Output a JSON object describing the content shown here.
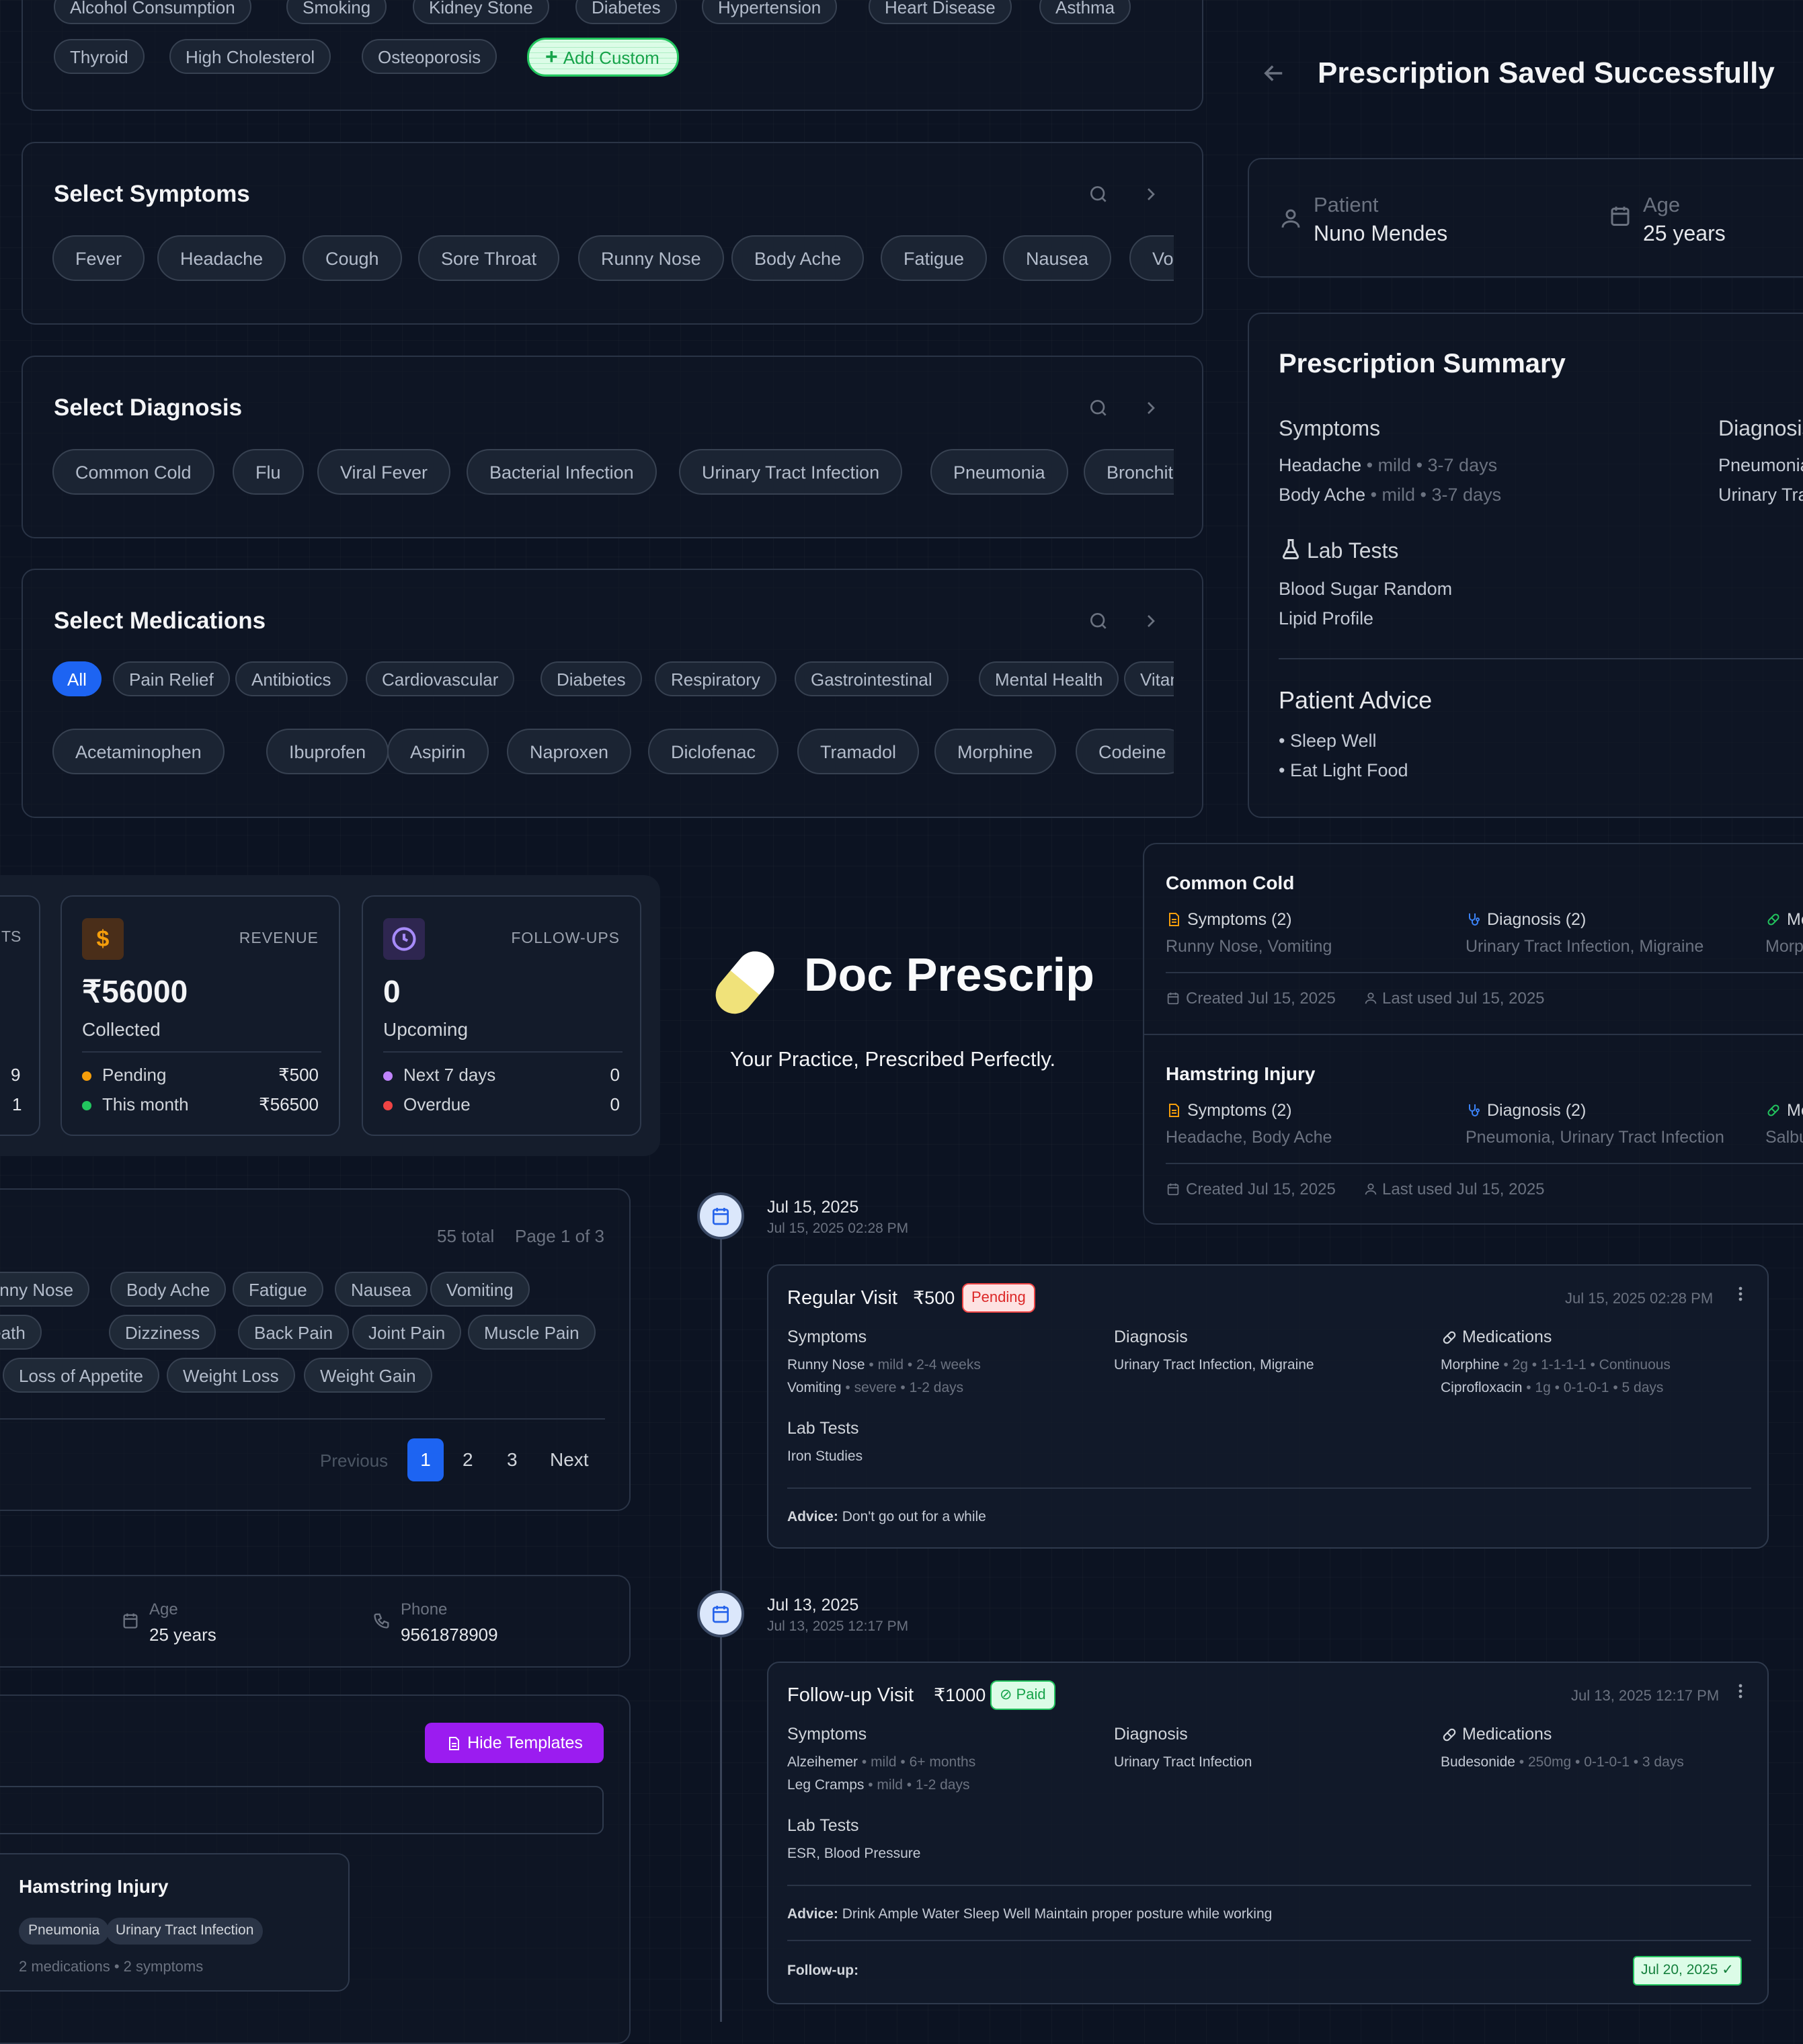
{
  "history_chips": [
    "Alcohol Consumption",
    "Smoking",
    "Kidney Stone",
    "Diabetes",
    "Hypertension",
    "Heart Disease",
    "Asthma",
    "Thyroid",
    "High Cholesterol",
    "Osteoporosis"
  ],
  "add_custom_label": "Add Custom",
  "symptoms": {
    "title": "Select Symptoms",
    "chips": [
      "Fever",
      "Headache",
      "Cough",
      "Sore Throat",
      "Runny Nose",
      "Body Ache",
      "Fatigue",
      "Nausea",
      "Vo"
    ]
  },
  "diagnosis": {
    "title": "Select Diagnosis",
    "chips": [
      "Common Cold",
      "Flu",
      "Viral Fever",
      "Bacterial Infection",
      "Urinary Tract Infection",
      "Pneumonia",
      "Bronchitis"
    ]
  },
  "medications": {
    "title": "Select Medications",
    "categories": [
      "All",
      "Pain Relief",
      "Antibiotics",
      "Cardiovascular",
      "Diabetes",
      "Respiratory",
      "Gastrointestinal",
      "Mental Health",
      "Vitamins"
    ],
    "chips": [
      "Acetaminophen",
      "Ibuprofen",
      "Aspirin",
      "Naproxen",
      "Diclofenac",
      "Tramadol",
      "Morphine",
      "Codeine"
    ]
  },
  "saved": {
    "title": "Prescription Saved Successfully",
    "patient_label": "Patient",
    "patient_name": "Nuno Mendes",
    "age_label": "Age",
    "age_value": "25 years"
  },
  "summary": {
    "title": "Prescription Summary",
    "symptoms_head": "Symptoms",
    "symptoms": [
      {
        "name": "Headache",
        "detail": " • mild • 3-7 days"
      },
      {
        "name": "Body Ache",
        "detail": " • mild • 3-7 days"
      }
    ],
    "diagnosis_head": "Diagnosis",
    "diagnosis": [
      "Pneumonia",
      "Urinary Tract Infection"
    ],
    "lab_head": "Lab Tests",
    "labs": [
      "Blood Sugar Random",
      "Lipid Profile"
    ],
    "advice_head": "Patient Advice",
    "advice": [
      "• Sleep Well",
      "• Eat Light Food"
    ]
  },
  "stats": {
    "left_label": "TS",
    "left_vals": [
      "9",
      "1"
    ],
    "revenue": {
      "label": "REVENUE",
      "icon": "$",
      "value": "₹56000",
      "sub": "Collected",
      "rows": [
        {
          "k": "Pending",
          "v": "₹500"
        },
        {
          "k": "This month",
          "v": "₹56500"
        }
      ]
    },
    "followups": {
      "label": "FOLLOW-UPS",
      "value": "0",
      "sub": "Upcoming",
      "rows": [
        {
          "k": "Next 7 days",
          "v": "0"
        },
        {
          "k": "Overdue",
          "v": "0"
        }
      ]
    }
  },
  "brand": {
    "name": "Doc Prescrip",
    "tagline": "Your Practice, Prescribed Perfectly."
  },
  "templates": [
    {
      "title": "Common Cold",
      "sym_head": "Symptoms (2)",
      "sym": "Runny Nose, Vomiting",
      "diag_head": "Diagnosis (2)",
      "diag": "Urinary Tract Infection, Migraine",
      "med_head": "Medications",
      "med": "Morphine",
      "created": "Created Jul 15, 2025",
      "used": "Last used Jul 15, 2025"
    },
    {
      "title": "Hamstring Injury",
      "sym_head": "Symptoms (2)",
      "sym": "Headache, Body Ache",
      "diag_head": "Diagnosis (2)",
      "diag": "Pneumonia, Urinary Tract Infection",
      "med_head": "Medications",
      "med": "Salbutamol",
      "created": "Created Jul 15, 2025",
      "used": "Last used Jul 15, 2025"
    }
  ],
  "symptom_list": {
    "total": "55 total",
    "page": "Page 1 of 3",
    "row1": [
      "Runny Nose",
      "Body Ache",
      "Fatigue",
      "Nausea",
      "Vomiting"
    ],
    "row2": [
      "Shortness of Breath",
      "Dizziness",
      "Back Pain",
      "Joint Pain",
      "Muscle Pain"
    ],
    "row3": [
      "Loss of Appetite",
      "Weight Loss",
      "Weight Gain"
    ],
    "pager": {
      "prev": "Previous",
      "pages": [
        "1",
        "2",
        "3"
      ],
      "next": "Next"
    }
  },
  "patient_strip": {
    "age_label": "Age",
    "age": "25 years",
    "phone_label": "Phone",
    "phone": "9561878909"
  },
  "template_panel": {
    "hide_label": "Hide Templates",
    "card": {
      "title": "Hamstring Injury",
      "tags": [
        "Pneumonia",
        "Urinary Tract Infection"
      ],
      "meta": "2 medications • 2 symptoms"
    }
  },
  "timeline": [
    {
      "date": "Jul 15, 2025",
      "datetime": "Jul 15, 2025 02:28 PM",
      "visit": "Regular Visit",
      "amount": "₹500",
      "status": "Pending",
      "stamp": "Jul 15, 2025 02:28 PM",
      "sym_head": "Symptoms",
      "symptoms": [
        {
          "name": "Runny Nose",
          "detail": " • mild • 2-4 weeks"
        },
        {
          "name": "Vomiting",
          "detail": " • severe • 1-2 days"
        }
      ],
      "diag_head": "Diagnosis",
      "diagnosis": "Urinary Tract Infection, Migraine",
      "med_head": "Medications",
      "meds": [
        {
          "name": "Morphine",
          "detail": " • 2g • 1-1-1-1 • Continuous"
        },
        {
          "name": "Ciprofloxacin",
          "detail": " • 1g • 0-1-0-1 • 5 days"
        }
      ],
      "lab_head": "Lab Tests",
      "labs": "Iron Studies",
      "advice_label": "Advice:",
      "advice": " Don't go out for a while"
    },
    {
      "date": "Jul 13, 2025",
      "datetime": "Jul 13, 2025 12:17 PM",
      "visit": "Follow-up Visit",
      "amount": "₹1000",
      "status": "Paid",
      "stamp": "Jul 13, 2025 12:17 PM",
      "sym_head": "Symptoms",
      "symptoms": [
        {
          "name": "Alzeihemer",
          "detail": " • mild • 6+ months"
        },
        {
          "name": "Leg Cramps",
          "detail": " • mild • 1-2 days"
        }
      ],
      "diag_head": "Diagnosis",
      "diagnosis": "Urinary Tract Infection",
      "med_head": "Medications",
      "meds": [
        {
          "name": "Budesonide",
          "detail": " • 250mg • 0-1-0-1 • 3 days"
        }
      ],
      "lab_head": "Lab Tests",
      "labs": "ESR, Blood Pressure",
      "advice_label": "Advice:",
      "advice": " Drink Ample Water Sleep Well Maintain proper posture while working",
      "followup_label": "Follow-up:",
      "followup_date": "Jul 20, 2025 ✓"
    }
  ],
  "colors": {
    "bg": "#0c1322",
    "accent_blue": "#1d64f2",
    "accent_green": "#22c55e",
    "accent_purple": "#9b1cf0",
    "pending_red": "#ef4444",
    "orange": "#f59e0b"
  }
}
